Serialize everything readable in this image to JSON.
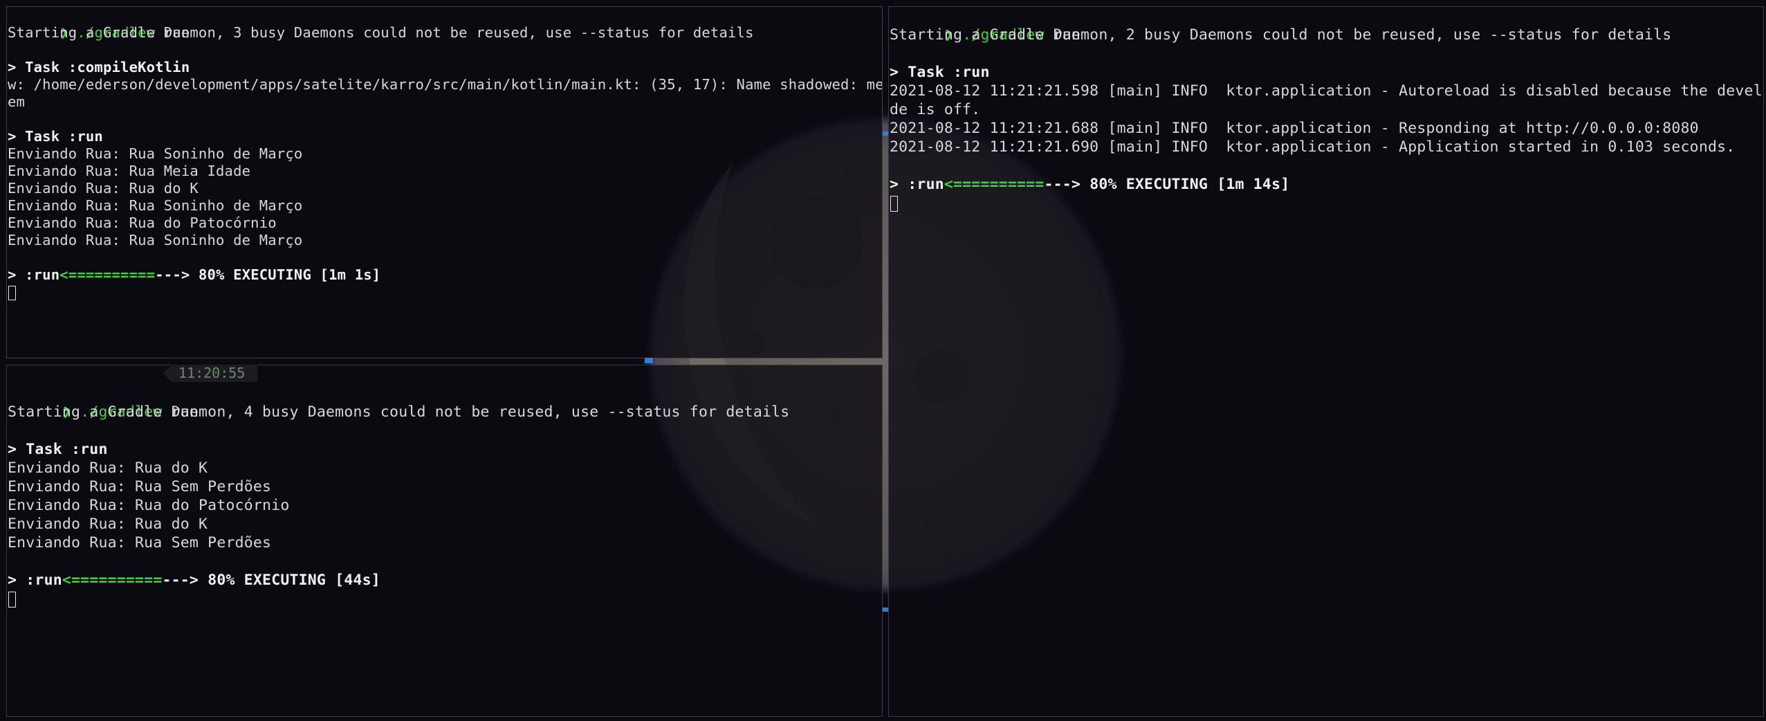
{
  "theme": {
    "background": "#0b0a10",
    "prompt_color": "#3fd13f",
    "text_color": "#d8d8da",
    "border_color": "#3a3a44",
    "focus_accent": "#2f7fd8"
  },
  "wallpaper": {
    "subject": "moon"
  },
  "status": {
    "time": "11:20:55"
  },
  "panes": {
    "top_left": {
      "prompt": {
        "symbol": "❯",
        "command": "./gradlew",
        "arg": " run"
      },
      "daemon": "Starting a Gradle Daemon, 3 busy Daemons could not be reused, use --status for details",
      "task_compile": "> Task :compileKotlin",
      "warning_1": "w: /home/ederson/development/apps/satelite/karro/src/main/kotlin/main.kt: (35, 17): Name shadowed: mensag",
      "warning_2": "em",
      "task_run": "> Task :run",
      "output": [
        "Enviando Rua: Rua Soninho de Março",
        "Enviando Rua: Rua Meia Idade",
        "Enviando Rua: Rua do K",
        "Enviando Rua: Rua Soninho de Março",
        "Enviando Rua: Rua do Patocórnio",
        "Enviando Rua: Rua Soninho de Março"
      ],
      "progress": {
        "bar_done": "<==========",
        "bar_rest": "---> 80% EXECUTING [1m 1s]"
      },
      "current": "> :run"
    },
    "bottom_left": {
      "prompt": {
        "symbol": "❯",
        "command": "./gradlew",
        "arg": " run"
      },
      "daemon": "Starting a Gradle Daemon, 4 busy Daemons could not be reused, use --status for details",
      "task_run": "> Task :run",
      "output": [
        "Enviando Rua: Rua do K",
        "Enviando Rua: Rua Sem Perdões",
        "Enviando Rua: Rua do Patocórnio",
        "Enviando Rua: Rua do K",
        "Enviando Rua: Rua Sem Perdões"
      ],
      "progress": {
        "bar_done": "<==========",
        "bar_rest": "---> 80% EXECUTING [44s]"
      },
      "current": "> :run"
    },
    "right": {
      "prompt": {
        "symbol": "❯",
        "command": "./gradlew",
        "arg": " run"
      },
      "daemon": "Starting a Gradle Daemon, 2 busy Daemons could not be reused, use --status for details",
      "task_run": "> Task :run",
      "log_1a": "2021-08-12 11:21:21.598 [main] INFO  ktor.application - Autoreload is disabled because the development mo",
      "log_1b": "de is off.",
      "log_2": "2021-08-12 11:21:21.688 [main] INFO  ktor.application - Responding at http://0.0.0.0:8080",
      "log_3": "2021-08-12 11:21:21.690 [main] INFO  ktor.application - Application started in 0.103 seconds.",
      "progress": {
        "bar_done": "<==========",
        "bar_rest": "---> 80% EXECUTING [1m 14s]"
      },
      "current": "> :run"
    }
  }
}
